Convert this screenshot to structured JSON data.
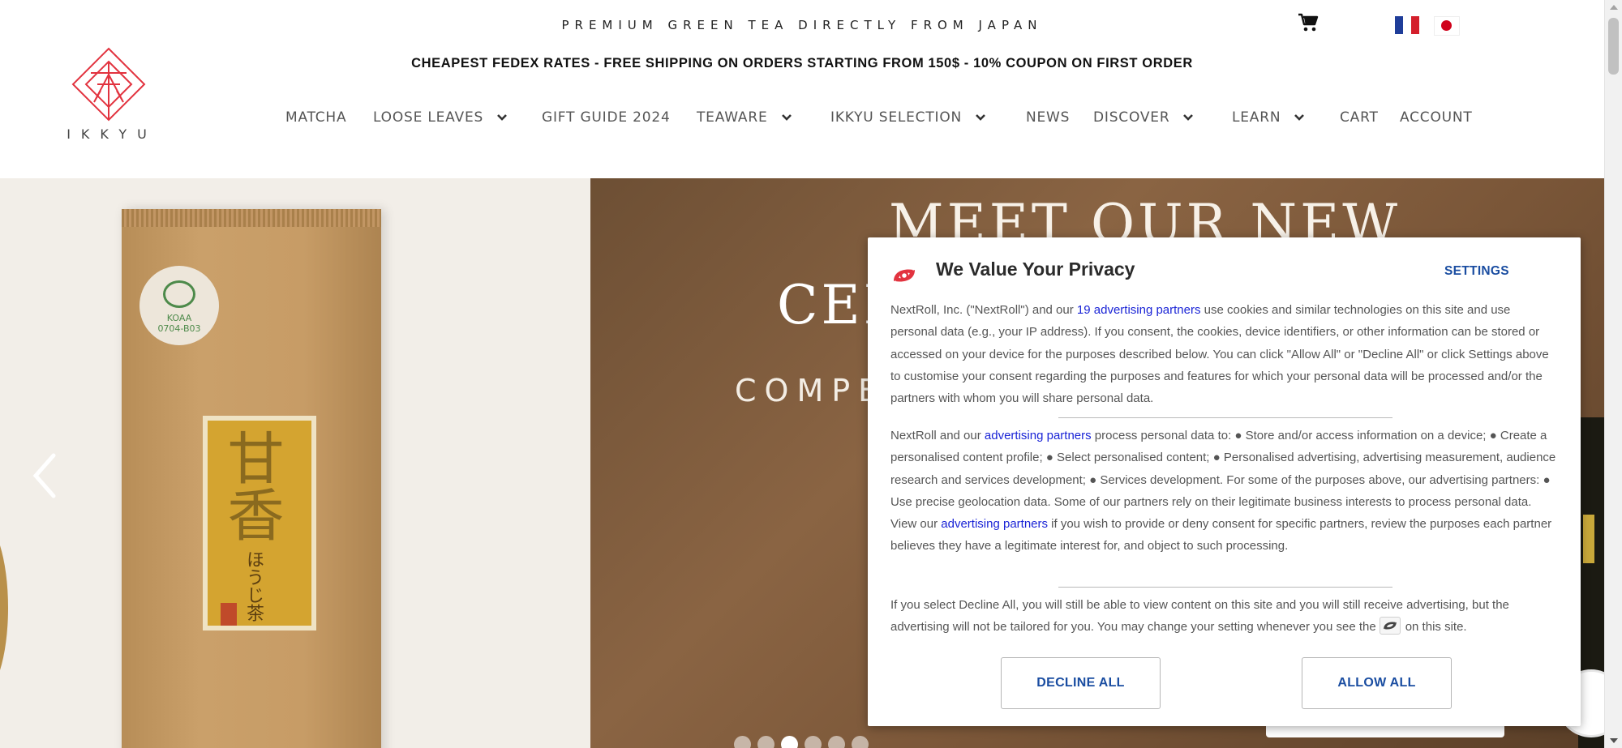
{
  "header": {
    "tagline": "PREMIUM GREEN TEA DIRECTLY FROM JAPAN",
    "shipping_banner": "CHEAPEST FEDEX RATES - FREE SHIPPING ON ORDERS STARTING FROM 150$ - 10% COUPON ON FIRST ORDER",
    "logo_text": "IKKYU",
    "icons": {
      "cart": "cart-icon",
      "flag_fr": "france-flag-icon",
      "flag_jp": "japan-flag-icon"
    },
    "nav": [
      {
        "label": "MATCHA",
        "has_dropdown": false
      },
      {
        "label": "LOOSE LEAVES",
        "has_dropdown": true
      },
      {
        "label": "GIFT GUIDE 2024",
        "has_dropdown": false
      },
      {
        "label": "TEAWARE",
        "has_dropdown": true
      },
      {
        "label": "IKKYU SELECTION",
        "has_dropdown": true
      },
      {
        "label": "NEWS",
        "has_dropdown": false
      },
      {
        "label": "DISCOVER",
        "has_dropdown": true
      },
      {
        "label": "LEARN",
        "has_dropdown": true
      },
      {
        "label": "CART",
        "has_dropdown": false
      },
      {
        "label": "ACCOUNT",
        "has_dropdown": false
      }
    ]
  },
  "hero": {
    "title_line1": "MEET OUR NEW",
    "title_line2": "CEI",
    "subtitle": "COMPE",
    "product_label_kanji": "甘香",
    "product_label_sub": "ほうじ茶",
    "jas_text": "KOAA\n0704-B03",
    "slide_count": 6,
    "active_slide": 3
  },
  "privacy_modal": {
    "title": "We Value Your Privacy",
    "settings_label": "SETTINGS",
    "para1": {
      "before": "NextRoll, Inc. (\"NextRoll\") and our ",
      "link": "19 advertising partners",
      "after": " use cookies and similar technologies on this site and use personal data (e.g., your IP address). If you consent, the cookies, device identifiers, or other information can be stored or accessed on your device for the purposes described below. You can click \"Allow All\" or \"Decline All\" or click Settings above to customise your consent regarding the purposes and features for which your personal data will be processed and/or the partners with whom you will share personal data."
    },
    "para2": {
      "before": "NextRoll and our ",
      "link1": "advertising partners",
      "middle": " process personal data to: ● Store and/or access information on a device; ● Create a personalised content profile; ● Select personalised content; ● Personalised advertising, advertising measurement, audience research and services development; ● Services development. For some of the purposes above, our advertising partners: ● Use precise geolocation data. Some of our partners rely on their legitimate business interests to process personal data. View our ",
      "link2": "advertising partners",
      "after": " if you wish to provide or deny consent for specific partners, review the purposes each partner believes they have a legitimate interest for, and object to such processing."
    },
    "para3": {
      "before": "If you select Decline All, you will still be able to view content on this site and you will still receive advertising, but the advertising will not be tailored for you. You may change your setting whenever you see the",
      "after": "on this site."
    },
    "decline_label": "DECLINE ALL",
    "allow_label": "ALLOW ALL",
    "colors": {
      "accent": "#1a4da1",
      "link": "#1a24d6",
      "logo": "#e2333f"
    }
  }
}
